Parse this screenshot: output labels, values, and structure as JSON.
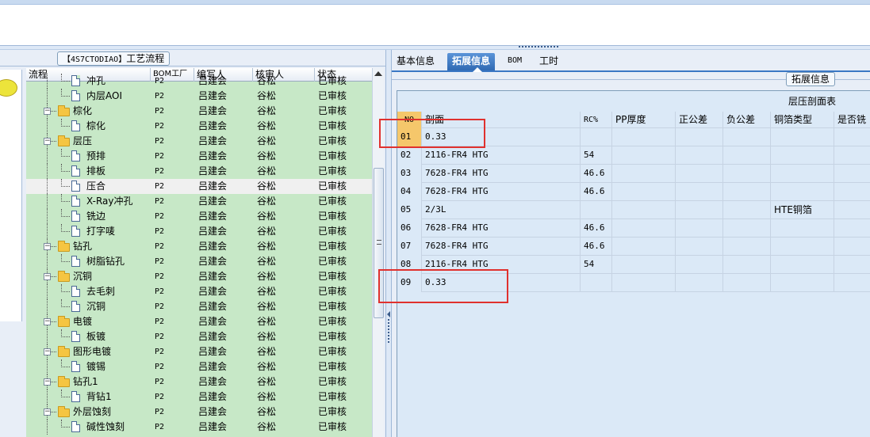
{
  "left_panel": {
    "group_title_code": "【4S7CTODIAO】",
    "group_title_text": "工艺流程",
    "columns": [
      "流程",
      "BOM工厂",
      "编写人",
      "核审人",
      "状态"
    ],
    "rows": [
      {
        "level": 2,
        "type": "doc",
        "name": "冲孔",
        "bom": "P2",
        "author": "吕建会",
        "reviewer": "谷松",
        "status": "已审核"
      },
      {
        "level": 2,
        "type": "doc",
        "name": "内层AOI",
        "bom": "P2",
        "author": "吕建会",
        "reviewer": "谷松",
        "status": "已审核"
      },
      {
        "level": 1,
        "type": "folder",
        "name": "棕化",
        "bom": "P2",
        "author": "吕建会",
        "reviewer": "谷松",
        "status": "已审核"
      },
      {
        "level": 2,
        "type": "doc",
        "name": "棕化",
        "bom": "P2",
        "author": "吕建会",
        "reviewer": "谷松",
        "status": "已审核"
      },
      {
        "level": 1,
        "type": "folder",
        "name": "层压",
        "bom": "P2",
        "author": "吕建会",
        "reviewer": "谷松",
        "status": "已审核"
      },
      {
        "level": 2,
        "type": "doc",
        "name": "预排",
        "bom": "P2",
        "author": "吕建会",
        "reviewer": "谷松",
        "status": "已审核"
      },
      {
        "level": 2,
        "type": "doc",
        "name": "排板",
        "bom": "P2",
        "author": "吕建会",
        "reviewer": "谷松",
        "status": "已审核"
      },
      {
        "level": 2,
        "type": "doc",
        "name": "压合",
        "bom": "P2",
        "author": "吕建会",
        "reviewer": "谷松",
        "status": "已审核",
        "selected": true
      },
      {
        "level": 2,
        "type": "doc",
        "name": "X-Ray冲孔",
        "bom": "P2",
        "author": "吕建会",
        "reviewer": "谷松",
        "status": "已审核"
      },
      {
        "level": 2,
        "type": "doc",
        "name": "铣边",
        "bom": "P2",
        "author": "吕建会",
        "reviewer": "谷松",
        "status": "已审核"
      },
      {
        "level": 2,
        "type": "doc",
        "name": "打字唛",
        "bom": "P2",
        "author": "吕建会",
        "reviewer": "谷松",
        "status": "已审核"
      },
      {
        "level": 1,
        "type": "folder",
        "name": "钻孔",
        "bom": "P2",
        "author": "吕建会",
        "reviewer": "谷松",
        "status": "已审核"
      },
      {
        "level": 2,
        "type": "doc",
        "name": "树脂钻孔",
        "bom": "P2",
        "author": "吕建会",
        "reviewer": "谷松",
        "status": "已审核"
      },
      {
        "level": 1,
        "type": "folder",
        "name": "沉铜",
        "bom": "P2",
        "author": "吕建会",
        "reviewer": "谷松",
        "status": "已审核"
      },
      {
        "level": 2,
        "type": "doc",
        "name": "去毛刺",
        "bom": "P2",
        "author": "吕建会",
        "reviewer": "谷松",
        "status": "已审核"
      },
      {
        "level": 2,
        "type": "doc",
        "name": "沉铜",
        "bom": "P2",
        "author": "吕建会",
        "reviewer": "谷松",
        "status": "已审核"
      },
      {
        "level": 1,
        "type": "folder",
        "name": "电镀",
        "bom": "P2",
        "author": "吕建会",
        "reviewer": "谷松",
        "status": "已审核"
      },
      {
        "level": 2,
        "type": "doc",
        "name": "板镀",
        "bom": "P2",
        "author": "吕建会",
        "reviewer": "谷松",
        "status": "已审核"
      },
      {
        "level": 1,
        "type": "folder",
        "name": "图形电镀",
        "bom": "P2",
        "author": "吕建会",
        "reviewer": "谷松",
        "status": "已审核"
      },
      {
        "level": 2,
        "type": "doc",
        "name": "镀锡",
        "bom": "P2",
        "author": "吕建会",
        "reviewer": "谷松",
        "status": "已审核"
      },
      {
        "level": 1,
        "type": "folder",
        "name": "钻孔1",
        "bom": "P2",
        "author": "吕建会",
        "reviewer": "谷松",
        "status": "已审核"
      },
      {
        "level": 2,
        "type": "doc",
        "name": "背钻1",
        "bom": "P2",
        "author": "吕建会",
        "reviewer": "谷松",
        "status": "已审核"
      },
      {
        "level": 1,
        "type": "folder",
        "name": "外层蚀刻",
        "bom": "P2",
        "author": "吕建会",
        "reviewer": "谷松",
        "status": "已审核"
      },
      {
        "level": 2,
        "type": "doc",
        "name": "碱性蚀刻",
        "bom": "P2",
        "author": "吕建会",
        "reviewer": "谷松",
        "status": "已审核"
      }
    ]
  },
  "right_panel": {
    "tabs": [
      {
        "label": "基本信息",
        "active": false
      },
      {
        "label": "拓展信息",
        "active": true
      },
      {
        "label": "BOM",
        "active": false
      },
      {
        "label": "工时",
        "active": false
      }
    ],
    "ext_title": "拓展信息",
    "table_caption": "层压剖面表",
    "columns": [
      "NO",
      "剖面",
      "RC%",
      "PP厚度",
      "正公差",
      "负公差",
      "铜箔类型",
      "是否铣"
    ],
    "rows": [
      [
        "01",
        "0.33",
        "",
        "",
        "",
        "",
        "",
        ""
      ],
      [
        "02",
        "2116-FR4 HTG",
        "54",
        "",
        "",
        "",
        "",
        ""
      ],
      [
        "03",
        "7628-FR4 HTG",
        "46.6",
        "",
        "",
        "",
        "",
        ""
      ],
      [
        "04",
        "7628-FR4 HTG",
        "46.6",
        "",
        "",
        "",
        "",
        ""
      ],
      [
        "05",
        "2/3L",
        "",
        "",
        "",
        "",
        "HTE铜箔",
        ""
      ],
      [
        "06",
        "7628-FR4 HTG",
        "46.6",
        "",
        "",
        "",
        "",
        ""
      ],
      [
        "07",
        "7628-FR4 HTG",
        "46.6",
        "",
        "",
        "",
        "",
        ""
      ],
      [
        "08",
        "2116-FR4 HTG",
        "54",
        "",
        "",
        "",
        "",
        ""
      ],
      [
        "09",
        "0.33",
        "",
        "",
        "",
        "",
        "",
        ""
      ]
    ]
  },
  "colors": {
    "tree_bg": "#c7e8c7",
    "tab_active": "#3a77c4",
    "table_bg": "#dbe9f7",
    "header_no": "#f5c76b",
    "highlight": "#e0312e"
  }
}
